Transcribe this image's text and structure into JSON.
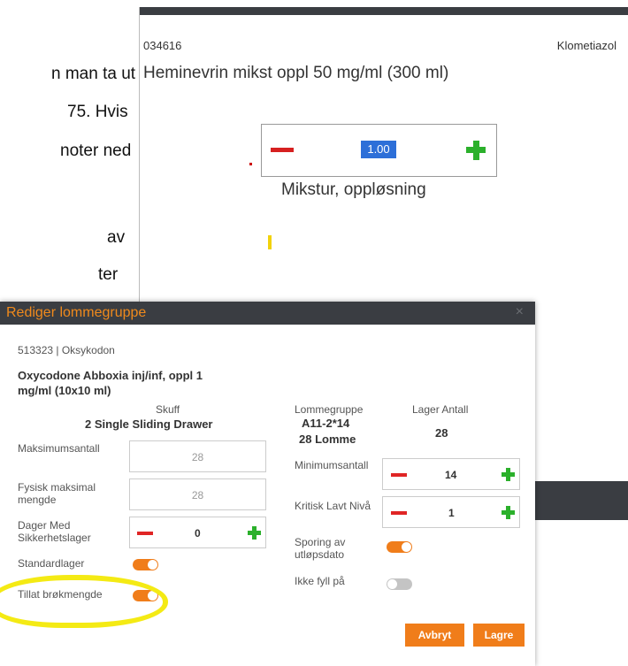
{
  "background_doc": {
    "lines": [
      "n man ta ut",
      "75. Hvis",
      "noter ned",
      "av",
      "ter"
    ]
  },
  "back_dialog": {
    "item_code": "034616",
    "drug_name": "Klometiazol",
    "product": "Heminevrin mikst oppl 50 mg/ml (300 ml)",
    "quantity": "1.00",
    "form": "Mikstur, oppløsning"
  },
  "dialog": {
    "title": "Rediger lommegruppe",
    "close": "×",
    "item_line": "513323 | Oksykodon",
    "product_name": "Oxycodone Abboxia inj/inf, oppl 1 mg/ml (10x10 ml)",
    "skuff_label": "Skuff",
    "skuff_value": "2 Single Sliding Drawer",
    "lommegruppe_label": "Lommegruppe",
    "lommegruppe_value_1": "A11-2*14",
    "lommegruppe_value_2": "28 Lomme",
    "lager_antall_label": "Lager Antall",
    "lager_antall_value": "28",
    "fields": {
      "maks_label": "Maksimumsantall",
      "maks_value": "28",
      "fysisk_label_1": "Fysisk maksimal",
      "fysisk_label_2": "mengde",
      "fysisk_value": "28",
      "dager_label_1": "Dager Med",
      "dager_label_2": "Sikkerhetslager",
      "dager_value": "0",
      "minimum_label": "Minimumsantall",
      "minimum_value": "14",
      "kritisk_label": "Kritisk Lavt Nivå",
      "kritisk_value": "1"
    },
    "toggles": {
      "standardlager_label": "Standardlager",
      "standardlager_on": true,
      "tillat_label": "Tillat brøkmengde",
      "tillat_on": true,
      "sporing_label_1": "Sporing av",
      "sporing_label_2": "utløpsdato",
      "sporing_on": true,
      "ikke_fyll_label": "Ikke fyll på",
      "ikke_fyll_on": false
    },
    "buttons": {
      "cancel": "Avbryt",
      "save": "Lagre"
    }
  },
  "colors": {
    "accent_orange": "#f07d1a",
    "title_orange": "#f08a1c",
    "header_dark": "#3a3d42",
    "minus_red": "#e02525",
    "plus_green": "#2bb02b",
    "highlight_yellow": "#f4ea14"
  }
}
